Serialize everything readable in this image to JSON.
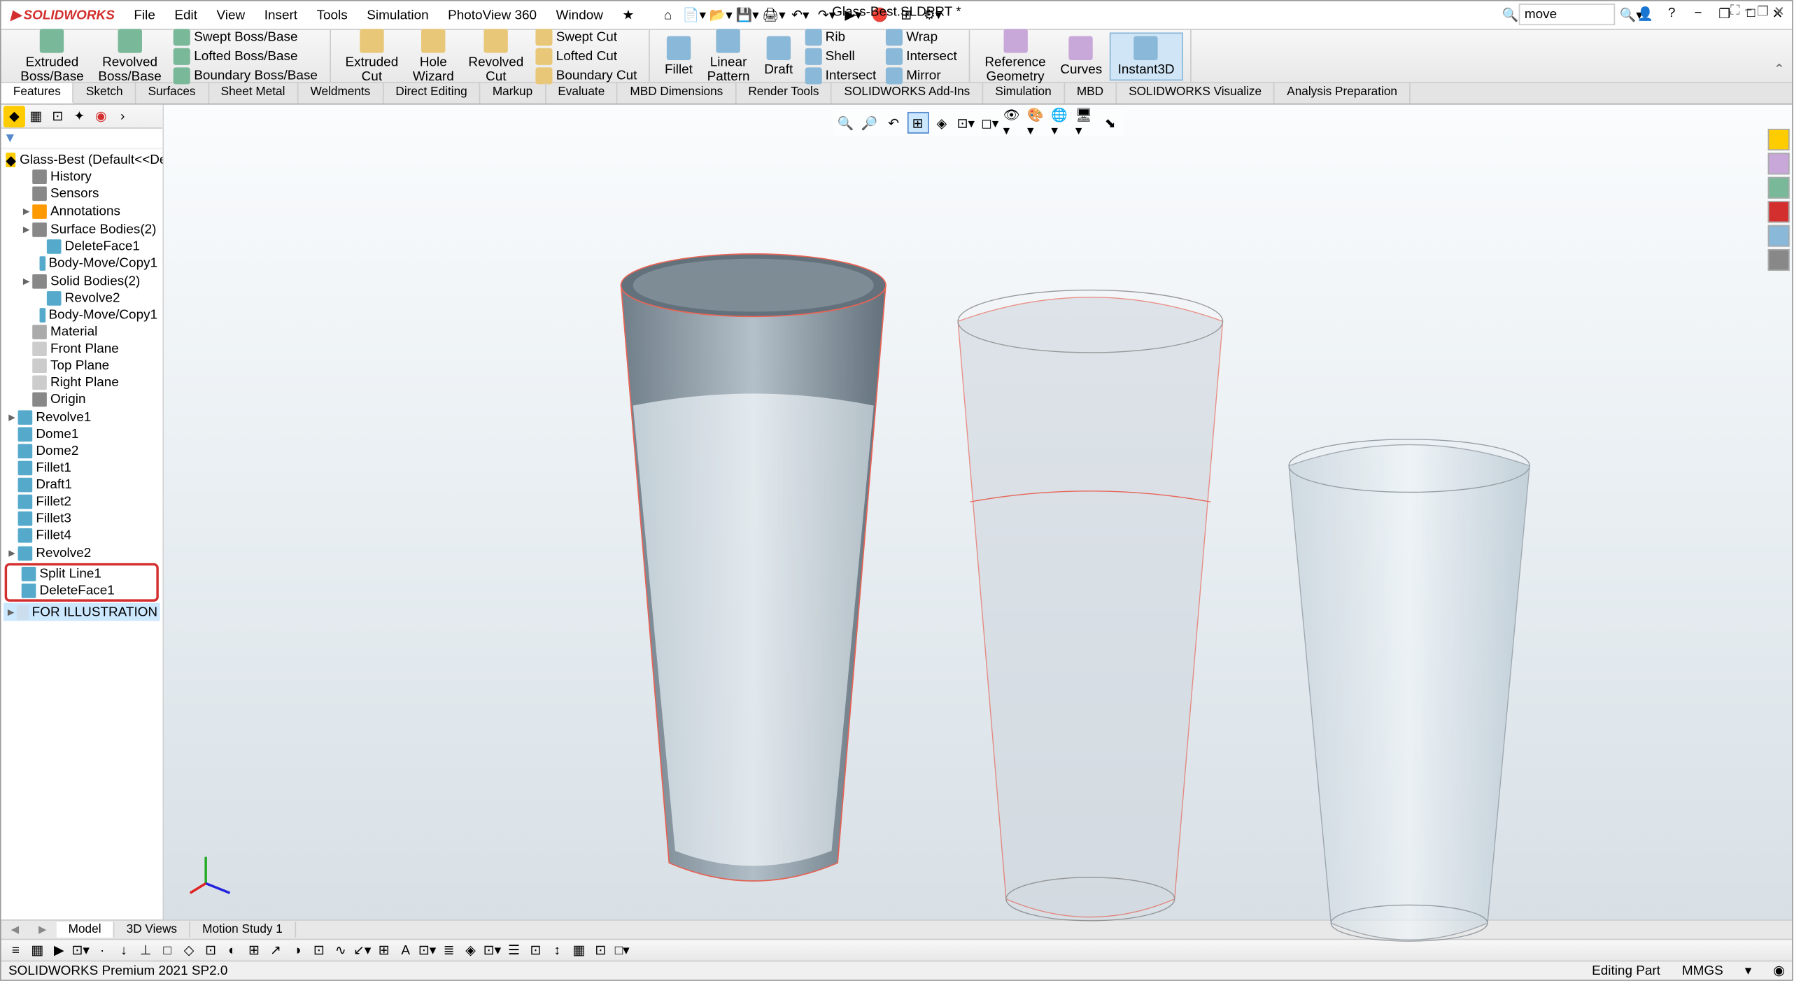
{
  "app": {
    "brand": "SOLIDWORKS",
    "title": "Glass-Best.SLDPRT *"
  },
  "menus": [
    "File",
    "Edit",
    "View",
    "Insert",
    "Tools",
    "Simulation",
    "PhotoView 360",
    "Window"
  ],
  "search": {
    "value": "move"
  },
  "ribbon": {
    "features_big": [
      {
        "label": "Extruded\nBoss/Base"
      },
      {
        "label": "Revolved\nBoss/Base"
      }
    ],
    "features_small1": [
      "Swept Boss/Base",
      "Lofted Boss/Base",
      "Boundary Boss/Base"
    ],
    "cut_big": [
      {
        "label": "Extruded\nCut"
      },
      {
        "label": "Hole\nWizard"
      },
      {
        "label": "Revolved\nCut"
      }
    ],
    "cut_small": [
      "Swept Cut",
      "Lofted Cut",
      "Boundary Cut"
    ],
    "pattern_big": [
      {
        "label": "Fillet"
      },
      {
        "label": "Linear\nPattern"
      },
      {
        "label": "Draft"
      }
    ],
    "pattern_small": [
      "Rib",
      "Shell",
      "Intersect"
    ],
    "pattern_small2": [
      "Wrap",
      "Intersect",
      "Mirror"
    ],
    "ref_big": [
      {
        "label": "Reference\nGeometry"
      },
      {
        "label": "Curves"
      },
      {
        "label": "Instant3D"
      }
    ]
  },
  "cmdtabs": [
    "Features",
    "Sketch",
    "Surfaces",
    "Sheet Metal",
    "Weldments",
    "Direct Editing",
    "Markup",
    "Evaluate",
    "MBD Dimensions",
    "Render Tools",
    "SOLIDWORKS Add-Ins",
    "Simulation",
    "MBD",
    "SOLIDWORKS Visualize",
    "Analysis Preparation"
  ],
  "tree": {
    "root": "Glass-Best  (Default<<Default>_Displa",
    "items": [
      {
        "t": "History",
        "i": 1,
        "c": "#888"
      },
      {
        "t": "Sensors",
        "i": 1,
        "c": "#888"
      },
      {
        "t": "Annotations",
        "i": 1,
        "c": "#f90",
        "exp": true
      },
      {
        "t": "Surface Bodies(2)",
        "i": 1,
        "c": "#888",
        "exp": true
      },
      {
        "t": "DeleteFace1",
        "i": 2,
        "c": "#5ac"
      },
      {
        "t": "Body-Move/Copy1",
        "i": 2,
        "c": "#5ac"
      },
      {
        "t": "Solid Bodies(2)",
        "i": 1,
        "c": "#888",
        "exp": true
      },
      {
        "t": "Revolve2",
        "i": 2,
        "c": "#5ac"
      },
      {
        "t": "Body-Move/Copy1",
        "i": 2,
        "c": "#5ac"
      },
      {
        "t": "Material <not specified>",
        "i": 1,
        "c": "#aaa"
      },
      {
        "t": "Front Plane",
        "i": 1,
        "c": "#ccc"
      },
      {
        "t": "Top Plane",
        "i": 1,
        "c": "#ccc"
      },
      {
        "t": "Right Plane",
        "i": 1,
        "c": "#ccc"
      },
      {
        "t": "Origin",
        "i": 1,
        "c": "#888"
      },
      {
        "t": "Revolve1",
        "i": 0,
        "c": "#5ac",
        "exp": true
      },
      {
        "t": "Dome1",
        "i": 0,
        "c": "#5ac"
      },
      {
        "t": "Dome2",
        "i": 0,
        "c": "#5ac"
      },
      {
        "t": "Fillet1",
        "i": 0,
        "c": "#5ac"
      },
      {
        "t": "Draft1",
        "i": 0,
        "c": "#5ac"
      },
      {
        "t": "Fillet2",
        "i": 0,
        "c": "#5ac"
      },
      {
        "t": "Fillet3",
        "i": 0,
        "c": "#5ac"
      },
      {
        "t": "Fillet4",
        "i": 0,
        "c": "#5ac"
      },
      {
        "t": "Revolve2",
        "i": 0,
        "c": "#5ac",
        "exp": true
      },
      {
        "t": "Split Line1",
        "i": 0,
        "c": "#5ac",
        "hl": true
      },
      {
        "t": "DeleteFace1",
        "i": 0,
        "c": "#5ac",
        "hl": true
      },
      {
        "t": "FOR ILLUSTRATION",
        "i": 0,
        "c": "#cde",
        "sel": true,
        "exp": true
      }
    ]
  },
  "bottom_tabs": [
    "Model",
    "3D Views",
    "Motion Study 1"
  ],
  "status": {
    "left": "SOLIDWORKS Premium 2021 SP2.0",
    "right_mode": "Editing Part",
    "units": "MMGS"
  }
}
